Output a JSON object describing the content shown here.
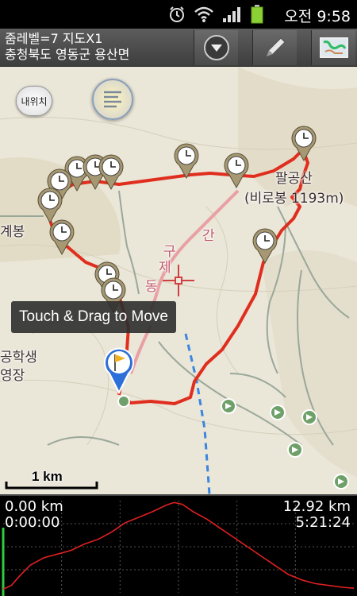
{
  "status_bar": {
    "clock": "오전 9:58",
    "icons": [
      "alarm-icon",
      "wifi-icon",
      "signal-icon",
      "battery-icon"
    ]
  },
  "toolbar": {
    "zoom_line": "줌레벨=7 지도X1",
    "location_line": "충청북도 영동군 용산면",
    "buttons": [
      "dropdown-icon",
      "pencil-icon",
      "map-icon"
    ]
  },
  "map": {
    "my_location_label": "내위치",
    "place_labels": {
      "peak_name": "팔공산",
      "peak_sub": "(비로봉 1193m)",
      "left_peak": "계봉",
      "left_lines": [
        "공학생",
        "영장"
      ],
      "road_char_1": "간",
      "road_char_2": "구",
      "road_char_3": "제",
      "road_char_4": "동"
    },
    "tooltip": "Touch & Drag to Move",
    "scale_label": "1 km",
    "colors": {
      "track": "#e02e1e",
      "marker": "#9c9070",
      "background": "#eae6d8"
    }
  },
  "profile": {
    "start_distance": "0.00 km",
    "start_time": "0:00:00",
    "total_distance": "12.92 km",
    "total_time": "5:21:24",
    "chart_data": {
      "type": "line",
      "x_unit": "km",
      "y_unit": "elevation (relative)",
      "x": [
        0,
        0.3,
        0.6,
        1.0,
        1.5,
        2.0,
        2.5,
        3.0,
        3.5,
        4.0,
        4.5,
        5.0,
        5.5,
        6.0,
        6.3,
        6.6,
        7.0,
        7.5,
        8.0,
        8.5,
        9.0,
        9.5,
        10.0,
        10.5,
        11.0,
        11.5,
        12.0,
        12.5,
        12.92
      ],
      "y": [
        4,
        8,
        18,
        30,
        38,
        42,
        46,
        53,
        58,
        66,
        76,
        82,
        88,
        95,
        98,
        96,
        88,
        80,
        70,
        60,
        50,
        40,
        30,
        20,
        14,
        10,
        8,
        6,
        5
      ],
      "color": "#e02020",
      "grid": true
    }
  }
}
